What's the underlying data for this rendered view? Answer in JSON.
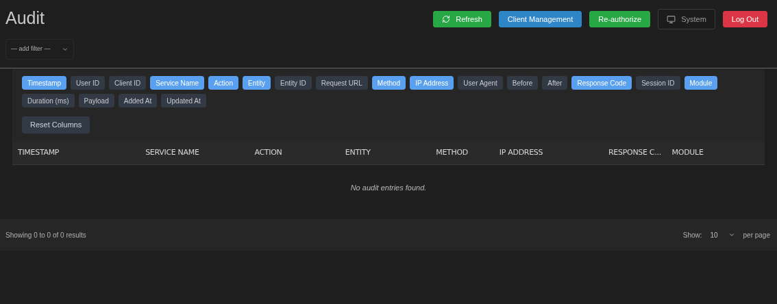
{
  "header": {
    "title": "Audit",
    "buttons": [
      {
        "label": "Refresh",
        "kind": "refresh"
      },
      {
        "label": "Client Management",
        "kind": "primary"
      },
      {
        "label": "Re-authorize",
        "kind": "confirm"
      },
      {
        "label": "System",
        "kind": "system"
      },
      {
        "label": "Log Out",
        "kind": "logout"
      }
    ]
  },
  "filter": {
    "value": "— add filter —"
  },
  "column_toggles": [
    {
      "label": "Timestamp",
      "selected": true
    },
    {
      "label": "User ID",
      "selected": false
    },
    {
      "label": "Client ID",
      "selected": false
    },
    {
      "label": "Service Name",
      "selected": true
    },
    {
      "label": "Action",
      "selected": true
    },
    {
      "label": "Entity",
      "selected": true
    },
    {
      "label": "Entity ID",
      "selected": false
    },
    {
      "label": "Request URL",
      "selected": false
    },
    {
      "label": "Method",
      "selected": true
    },
    {
      "label": "IP Address",
      "selected": true
    },
    {
      "label": "User Agent",
      "selected": false
    },
    {
      "label": "Before",
      "selected": false
    },
    {
      "label": "After",
      "selected": false
    },
    {
      "label": "Response Code",
      "selected": true
    },
    {
      "label": "Session ID",
      "selected": false
    },
    {
      "label": "Module",
      "selected": true
    },
    {
      "label": "Duration (ms)",
      "selected": false
    },
    {
      "label": "Payload",
      "selected": false
    },
    {
      "label": "Added At",
      "selected": false
    },
    {
      "label": "Updated At",
      "selected": false
    }
  ],
  "reset_button": "Reset Columns",
  "table": {
    "columns": [
      "TIMESTAMP",
      "SERVICE NAME",
      "ACTION",
      "ENTITY",
      "METHOD",
      "IP ADDRESS",
      "RESPONSE C...",
      "MODULE"
    ],
    "empty_message": "No audit entries found."
  },
  "footer": {
    "summary": "Showing 0 to 0 of 0 results",
    "show_label": "Show:",
    "page_size": "10",
    "per_page_label": "per page"
  }
}
